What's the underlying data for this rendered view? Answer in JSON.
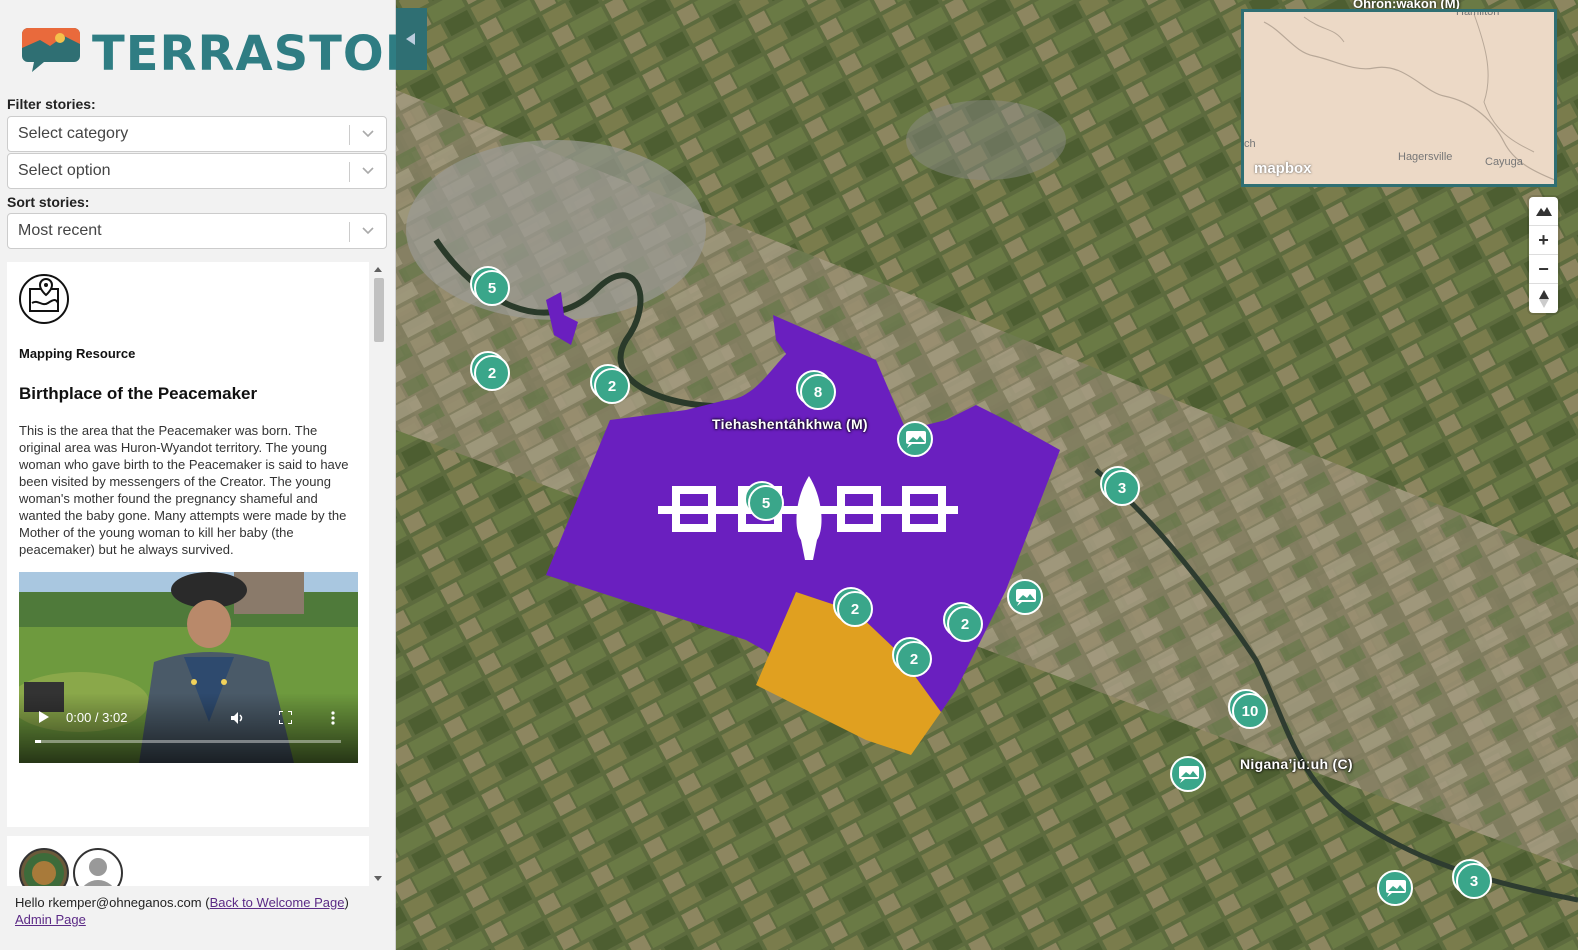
{
  "app": {
    "name": "TERRASTORIES"
  },
  "filters": {
    "filter_label": "Filter stories:",
    "category_placeholder": "Select category",
    "option_placeholder": "Select option",
    "sort_label": "Sort stories:",
    "sort_value": "Most recent"
  },
  "stories": [
    {
      "icon": "mapping-resource-icon",
      "category": "Mapping Resource",
      "title": "Birthplace of the Peacemaker",
      "description": "This is the area that the Peacemaker was born. The original area was Huron-Wyandot territory. The young woman who gave birth to the Peacemaker is said to have been visited by messengers of the Creator. The young woman's mother found the pregnancy shameful and wanted the baby gone. Many attempts were made by the Mother of the young woman to kill her baby (the peacemaker) but he always survived.",
      "video": {
        "time": "0:00 / 3:02",
        "progress": 0.02
      }
    }
  ],
  "footer": {
    "greeting": "Hello rkemper@ohneganos.com (",
    "back_link": "Back to Welcome Page",
    "close_paren": ")",
    "admin_link": "Admin Page"
  },
  "map": {
    "place_labels": [
      "Tiehashentáhkhwa (M)",
      "Niganaʼjúːuh (C)",
      "Ohron:wakon (M)"
    ],
    "clusters": [
      "5",
      "2",
      "2",
      "8",
      "5",
      "3",
      "2",
      "2",
      "2",
      "10",
      "3"
    ],
    "minimap": {
      "labels": [
        "Hamilton",
        "Hagersville",
        "Cayuga",
        "ch"
      ],
      "attribution": "mapbox"
    },
    "controls": [
      "compass",
      "+",
      "−",
      "north"
    ],
    "colors": {
      "territory_purple": "#6a1fbf",
      "territory_orange": "#e0a020",
      "marker_green": "#3aa68a",
      "panel_teal": "#2f6f73"
    }
  }
}
